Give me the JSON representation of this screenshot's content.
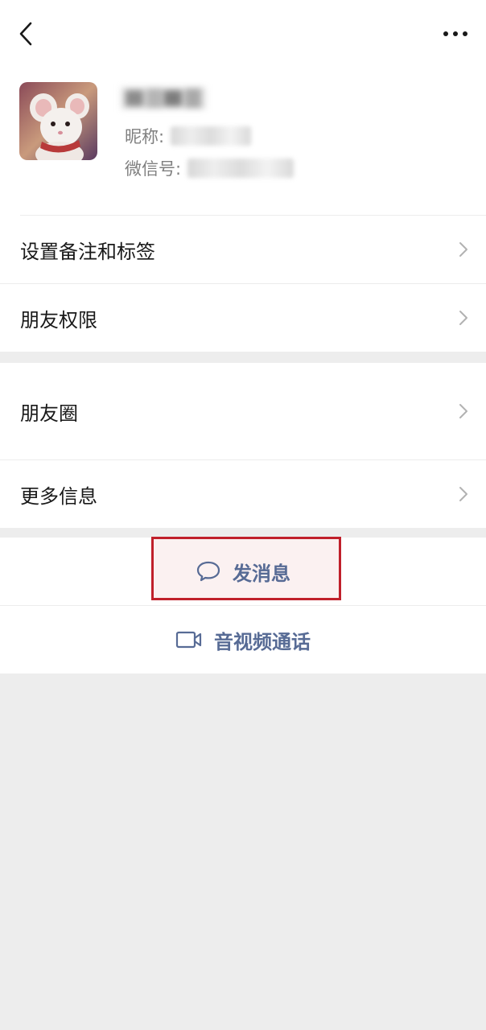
{
  "header": {
    "back_icon": "chevron-left-icon",
    "more_icon": "ellipsis-icon"
  },
  "profile": {
    "nickname_label": "昵称:",
    "wechat_id_label": "微信号:"
  },
  "menu": {
    "remark_tags": "设置备注和标签",
    "friend_permissions": "朋友权限",
    "moments": "朋友圈",
    "more_info": "更多信息"
  },
  "actions": {
    "send_message": "发消息",
    "send_message_icon": "chat-bubble-icon",
    "av_call": "音视频通话",
    "av_call_icon": "video-camera-icon"
  },
  "colors": {
    "link": "#576b95",
    "highlight_border": "#c0202b",
    "background": "#ededed"
  }
}
